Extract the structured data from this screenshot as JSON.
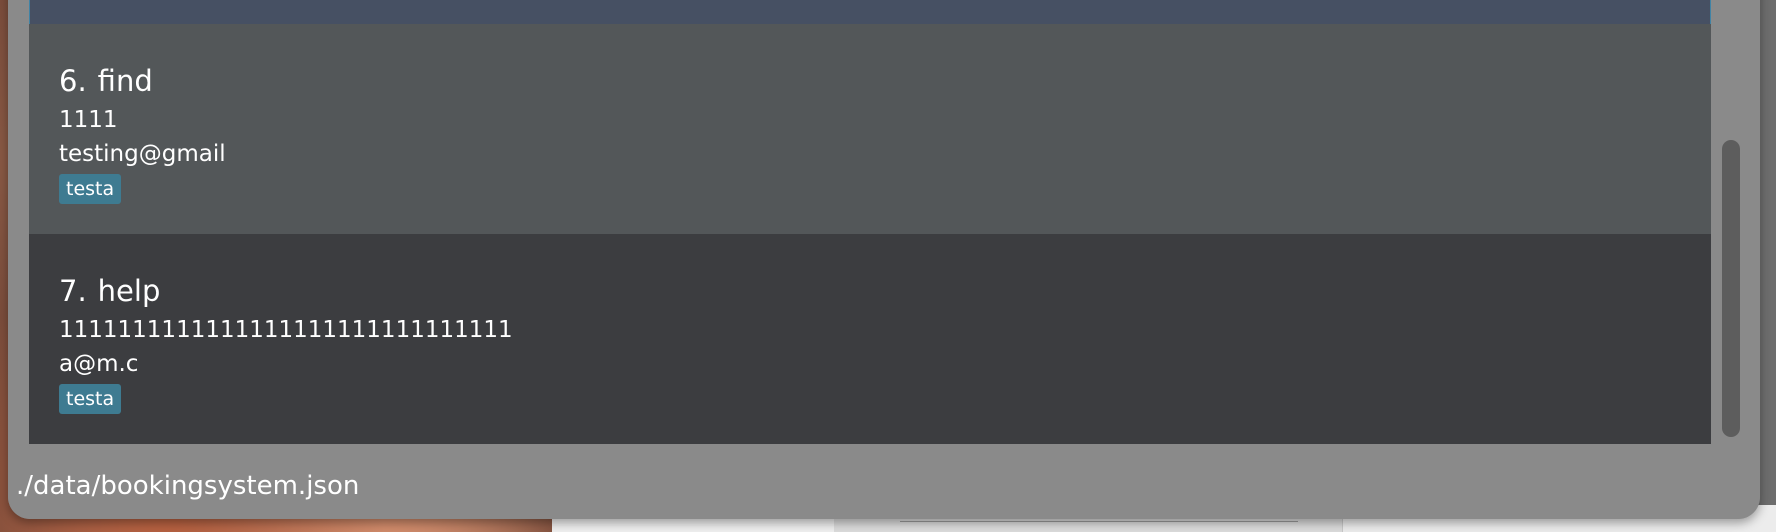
{
  "person_list": {
    "cards": [
      {
        "index": "6.",
        "name": "find",
        "phone": "1111",
        "email": "testing@gmail",
        "tags": [
          "testa"
        ]
      },
      {
        "index": "7.",
        "name": "help",
        "phone": "1111111111111111111111111111111",
        "email": "a@m.c",
        "tags": [
          "testa"
        ]
      }
    ]
  },
  "status_bar": {
    "save_location": "./data/bookingsystem.json"
  },
  "colors": {
    "window_bg": "#8a8a8a",
    "card_odd_bg": "#535759",
    "card_even_bg": "#3c3d40",
    "selected_card_bg": "#465063",
    "selected_border": "#3f83a5",
    "tag_bg": "#3e7b91",
    "text": "#ffffff"
  }
}
